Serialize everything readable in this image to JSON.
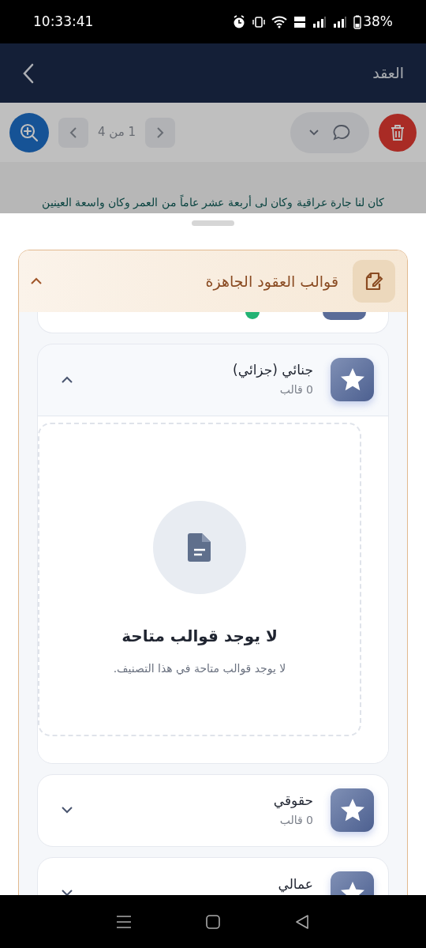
{
  "status_bar": {
    "time": "10:33:41",
    "battery": "38%"
  },
  "header": {
    "title": "العقد"
  },
  "toolbar": {
    "page_indicator": "1 من 4"
  },
  "document": {
    "text": "كان لنا جارة عراقية وكان لى أربعة عشر عاماً من العمر وكان واسعة العينين"
  },
  "templates_panel": {
    "title": "قوالب العقود الجاهزة",
    "expanded": true,
    "categories": [
      {
        "name": "جنائي (جزائي)",
        "count": "0 قالب",
        "expanded": true,
        "empty_state": {
          "title": "لا يوجد قوالب متاحة",
          "message": "لا يوجد قوالب متاحة في هذا التصنيف."
        }
      },
      {
        "name": "حقوقي",
        "count": "0 قالب",
        "expanded": false
      },
      {
        "name": "عمالي",
        "expanded": false
      }
    ]
  }
}
